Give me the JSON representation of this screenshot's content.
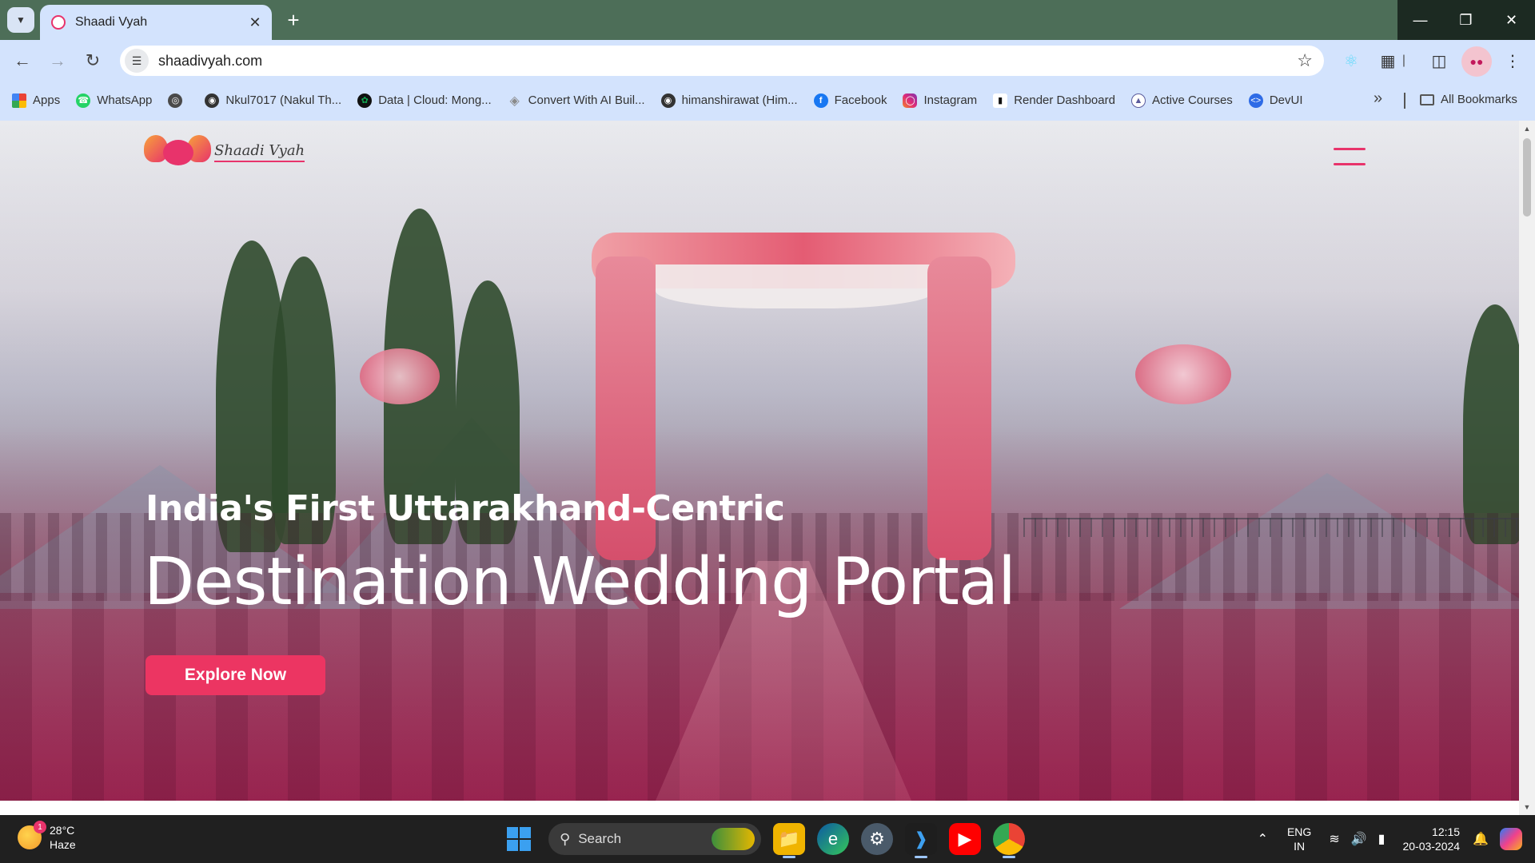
{
  "browser": {
    "tab": {
      "title": "Shaadi Vyah"
    },
    "address": {
      "url": "shaadivyah.com"
    },
    "bookmarks": [
      {
        "label": "Apps",
        "icon": "apps-grid-icon",
        "color": "#4285f4"
      },
      {
        "label": "WhatsApp",
        "icon": "whatsapp-icon",
        "color": "#25d366"
      },
      {
        "label": "",
        "icon": "globe-icon",
        "color": "#555555"
      },
      {
        "label": "Nkul7017 (Nakul Th...",
        "icon": "github-icon",
        "color": "#333333"
      },
      {
        "label": "Data | Cloud: Mong...",
        "icon": "mongodb-leaf-icon",
        "color": "#13aa52"
      },
      {
        "label": "Convert With AI Buil...",
        "icon": "diamond-icon",
        "color": "#8a8a8a"
      },
      {
        "label": "himanshirawat (Him...",
        "icon": "github-icon",
        "color": "#333333"
      },
      {
        "label": "Facebook",
        "icon": "facebook-icon",
        "color": "#1877f2"
      },
      {
        "label": "Instagram",
        "icon": "instagram-icon",
        "color": "#e1306c"
      },
      {
        "label": "Render Dashboard",
        "icon": "render-icon",
        "color": "#ffffff"
      },
      {
        "label": "Active Courses",
        "icon": "courses-icon",
        "color": "#5b5b9c"
      },
      {
        "label": "DevUI",
        "icon": "devui-icon",
        "color": "#2e6be6"
      }
    ],
    "all_bookmarks_label": "All Bookmarks"
  },
  "page": {
    "logo_text": "Shaadi Vyah",
    "hero": {
      "subtitle": "India's First Uttarakhand-Centric",
      "title": "Destination Wedding Portal",
      "cta_label": "Explore Now"
    },
    "accent_color": "#ec3562"
  },
  "taskbar": {
    "weather": {
      "temp": "28°C",
      "condition": "Haze",
      "badge": "1"
    },
    "search_label": "Search",
    "language": {
      "line1": "ENG",
      "line2": "IN"
    },
    "clock": {
      "time": "12:15",
      "date": "20-03-2024"
    }
  }
}
